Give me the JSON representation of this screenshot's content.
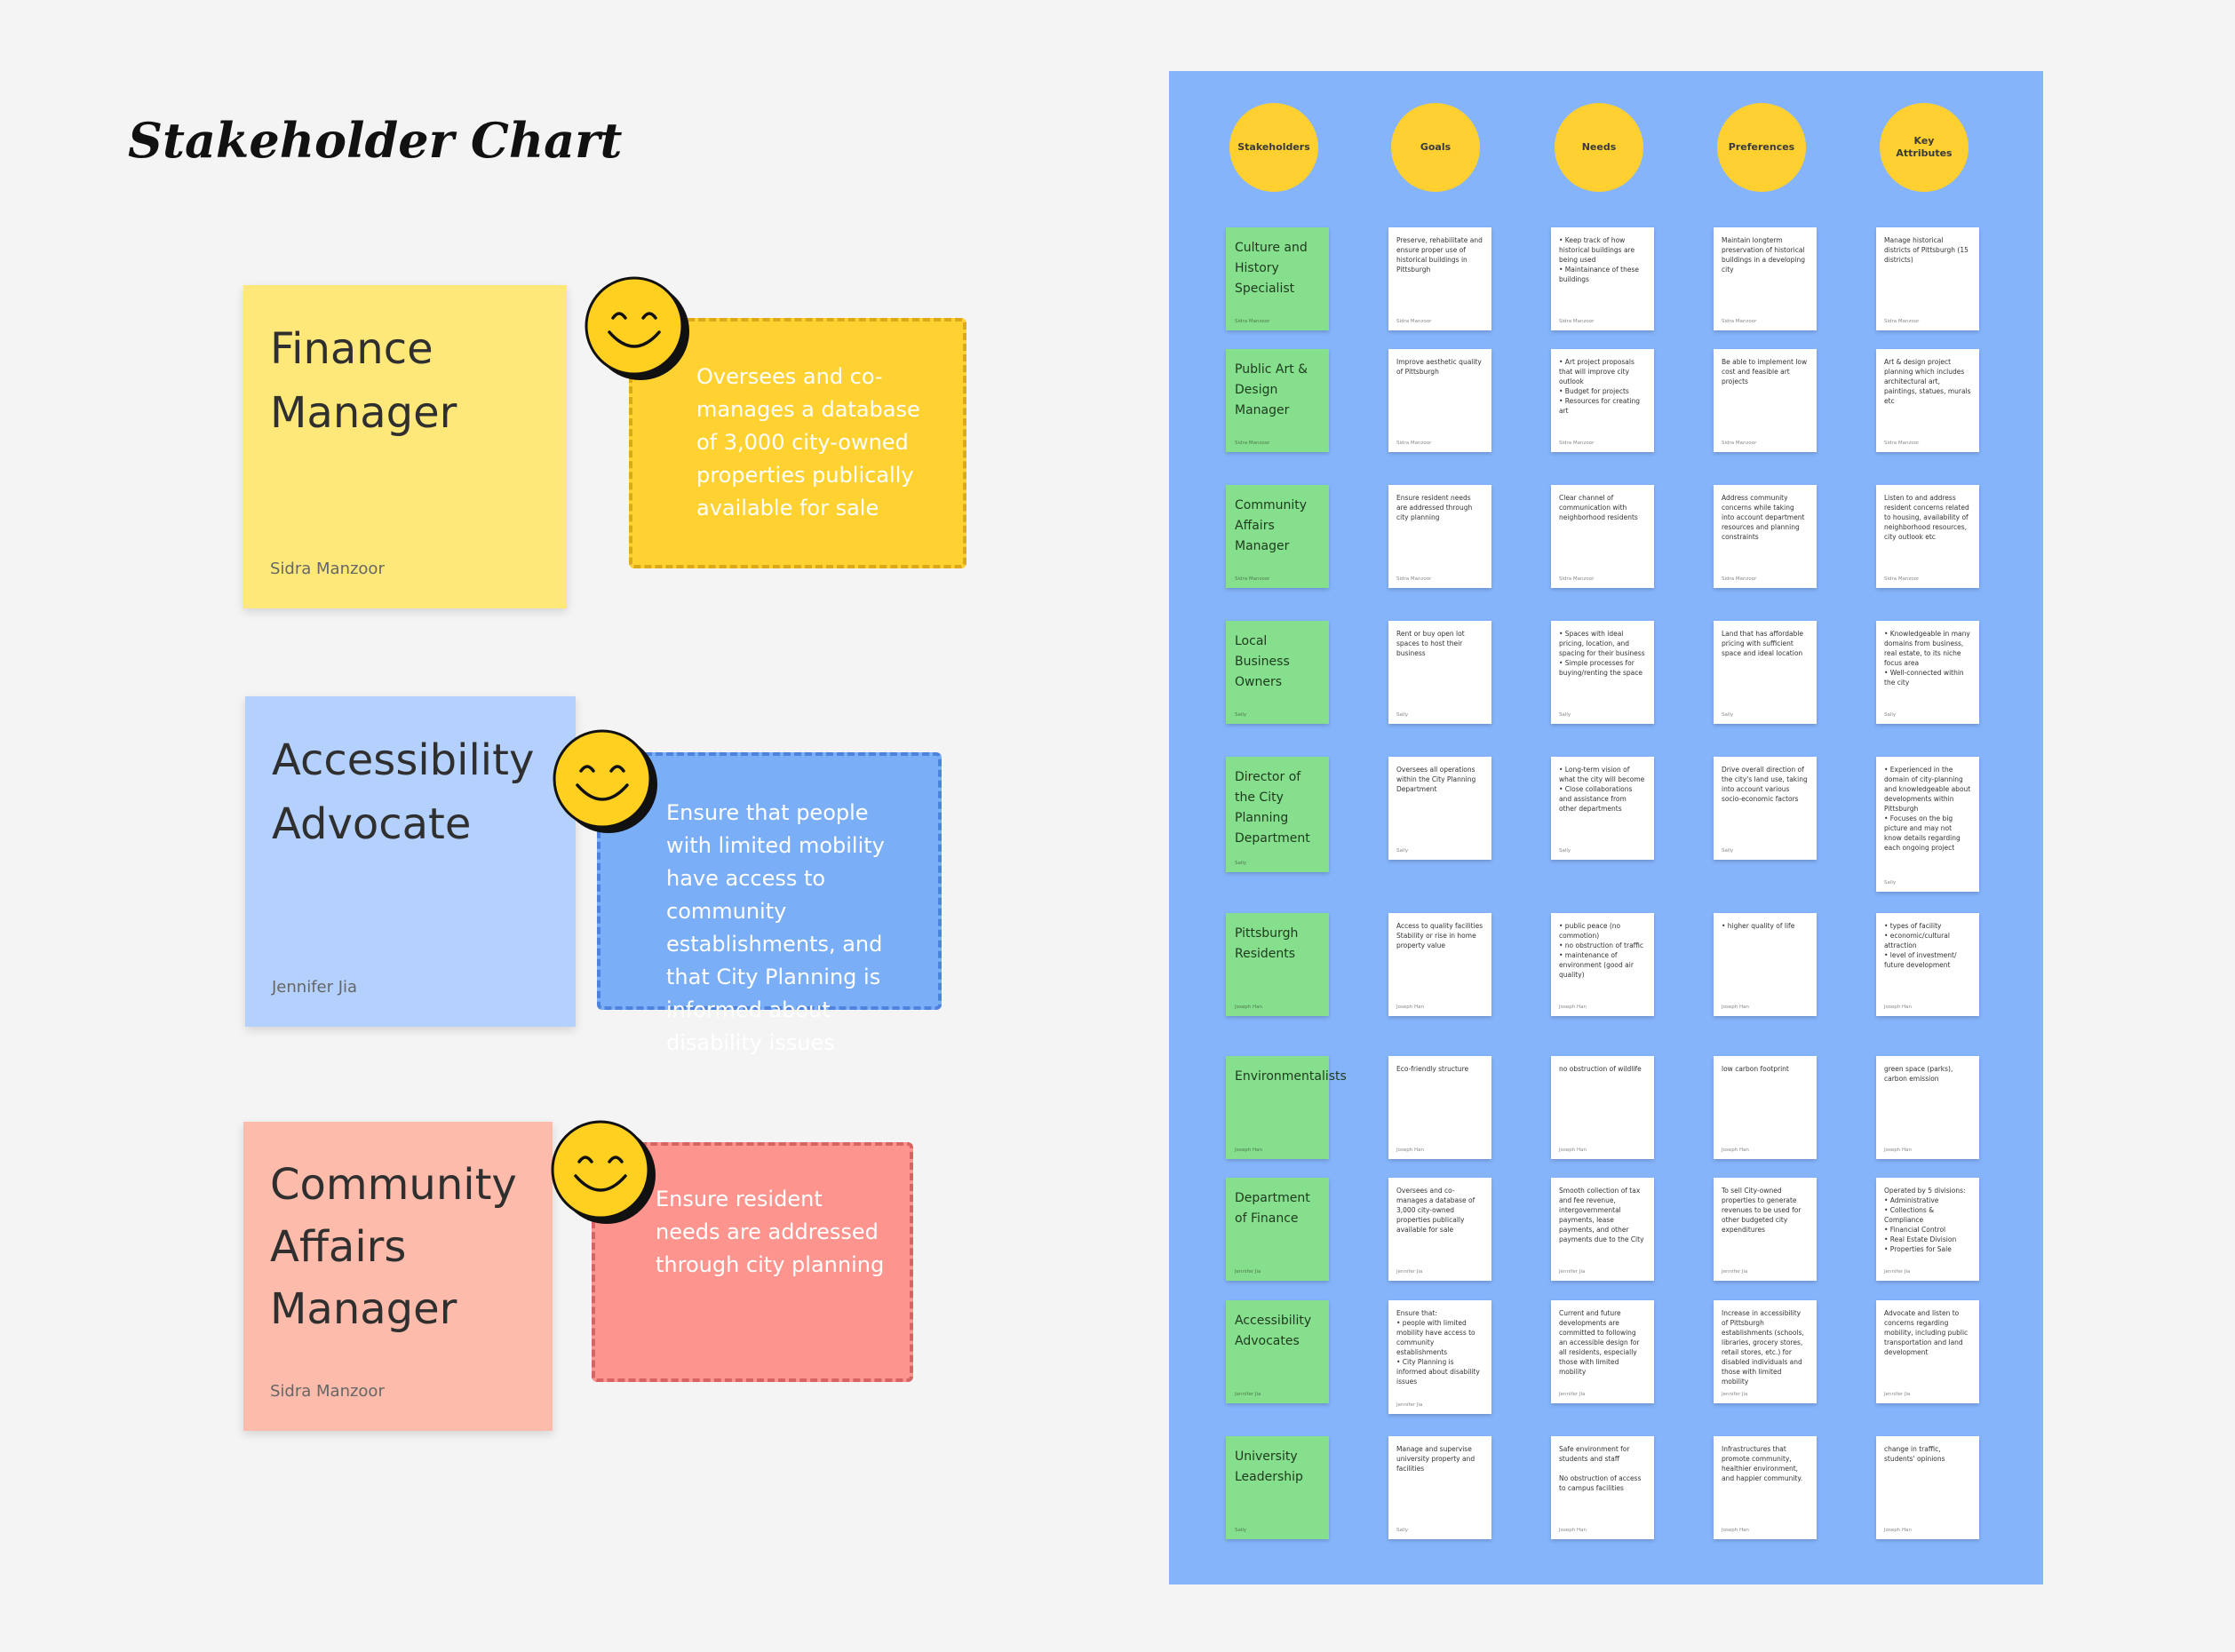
{
  "title": "Stakeholder Chart",
  "stickies": [
    {
      "role": "Finance Manager",
      "author": "Sidra Manzoor",
      "note": "Oversees and co-manages a database of 3,000 city-owned properties publically available for sale"
    },
    {
      "role": "Accessibility Advocate",
      "author": "Jennifer Jia",
      "note": "Ensure that people with limited mobility have access to community establishments, and that City Planning is informed about disability issues"
    },
    {
      "role": "Community Affairs Manager",
      "author": "Sidra Manzoor",
      "note": "Ensure resident needs are addressed through city planning"
    }
  ],
  "board": {
    "headers": [
      "Stakeholders",
      "Goals",
      "Needs",
      "Preferences",
      "Key Attributes"
    ],
    "rows": [
      {
        "stakeholder": "Culture and History Specialist",
        "author": "Sidra Manzoor",
        "cells": [
          "Preserve, rehabilitate and ensure proper use of historical buildings in Pittsburgh",
          "• Keep track of how historical buildings are being used\n• Maintainance of these buildings",
          "Maintain longterm preservation of historical buildings in a developing city",
          "Manage historical districts of Pittsburgh (15 districts)"
        ]
      },
      {
        "stakeholder": "Public Art & Design Manager",
        "author": "Sidra Manzoor",
        "cells": [
          "Improve aesthetic quality of Pittsburgh",
          "• Art project proposals that will improve city outlook\n• Budget for projects\n• Resources for creating art",
          "Be able to implement low cost and feasible art projects",
          "Art & design project planning which includes architectural art, paintings, statues, murals etc"
        ]
      },
      {
        "stakeholder": "Community Affairs Manager",
        "author": "Sidra Manzoor",
        "cells": [
          "Ensure resident needs are addressed through city planning",
          "Clear channel of communication with neighborhood residents",
          "Address community concerns while taking into account department resources and planning constraints",
          "Listen to and address resident concerns related to housing, availability of neighborhood resources, city outlook etc"
        ]
      },
      {
        "stakeholder": "Local Business Owners",
        "author": "Sally",
        "cells": [
          "Rent or buy open lot spaces to host their business",
          "• Spaces with ideal pricing, location, and spacing for their business\n• Simple processes for buying/renting the space",
          "Land that has affordable pricing with sufficient space and ideal location",
          "• Knowledgeable in many domains from business, real estate, to its niche focus area\n• Well-connected within the city"
        ]
      },
      {
        "stakeholder": "Director of the City Planning Department",
        "author": "Sally",
        "cells": [
          "Oversees all operations within the City Planning Department",
          "• Long-term vision of what the city will become\n• Close collaborations and assistance from other departments",
          "Drive overall direction of the city's land use, taking into account various socio-economic factors",
          "• Experienced in the domain of city-planning and knowledgeable about developments within Pittsburgh\n• Focuses on the big picture and may not know details regarding each ongoing project"
        ]
      },
      {
        "stakeholder": "Pittsburgh Residents",
        "author": "Joseph Han",
        "cells": [
          "Access to quality facilities\nStability or rise in home property value",
          "• public peace (no commotion)\n• no obstruction of traffic\n• maintenance of environment (good air quality)",
          "• higher quality of life",
          "• types of facility\n• economic/cultural attraction\n• level of investment/ future development"
        ]
      },
      {
        "stakeholder": "Environmentalists",
        "author": "Joseph Han",
        "cells": [
          "Eco-friendly structure",
          "no obstruction of wildlife",
          "low carbon footprint",
          "green space (parks), carbon emission"
        ]
      },
      {
        "stakeholder": "Department of Finance",
        "author": "Jennifer Jia",
        "cells": [
          "Oversees and co-manages a database of 3,000 city-owned properties publically available for sale",
          "Smooth collection of tax and fee revenue, intergovernmental payments, lease payments, and other payments due to the City",
          "To sell City-owned properties to generate revenues to be used for other budgeted city expenditures",
          "Operated by 5 divisions:\n• Administrative\n• Collections & Compliance\n• Financial Control\n• Real Estate Division\n• Properties for Sale"
        ]
      },
      {
        "stakeholder": "Accessibility Advocates",
        "author": "Jennifer Jia",
        "cells": [
          "Ensure that:\n• people with limited mobility have access to community establishments\n• City Planning is informed about disability issues",
          "Current and future developments are committed to following an accessible design for all residents, especially those with limited mobility",
          "Increase in accessibility of Pittsburgh establishments (schools, libraries, grocery stores, retail stores, etc.) for disabled individuals and those with limited mobility",
          "Advocate and listen to concerns regarding mobility, including public transportation and land development"
        ]
      },
      {
        "stakeholder": "University Leadership",
        "author": "Sally",
        "cells": [
          "Manage and supervise university property and facilities",
          "Safe environment for students and staff\n\nNo obstruction of access to campus facilities",
          "Infrastructures that promote community, healthier environment, and happier community.",
          "change in traffic, students' opinions"
        ]
      }
    ],
    "cell_authors": [
      [
        "Sidra Manzoor",
        "Sidra Manzoor",
        "Sidra Manzoor",
        "Sidra Manzoor"
      ],
      [
        "Sidra Manzoor",
        "Sidra Manzoor",
        "Sidra Manzoor",
        "Sidra Manzoor"
      ],
      [
        "Sidra Manzoor",
        "Sidra Manzoor",
        "Sidra Manzoor",
        "Sidra Manzoor"
      ],
      [
        "Sally",
        "Sally",
        "Sally",
        "Sally"
      ],
      [
        "Sally",
        "Sally",
        "Sally",
        "Sally"
      ],
      [
        "Joseph Han",
        "Joseph Han",
        "Joseph Han",
        "Joseph Han"
      ],
      [
        "Joseph Han",
        "Joseph Han",
        "Joseph Han",
        "Joseph Han"
      ],
      [
        "Jennifer Jia",
        "Jennifer Jia",
        "Jennifer Jia",
        "Jennifer Jia"
      ],
      [
        "Jennifer Jia",
        "Jennifer Jia",
        "Jennifer Jia",
        "Jennifer Jia"
      ],
      [
        "Sally",
        "Joseph Han",
        "Joseph Han",
        "Joseph Han"
      ]
    ]
  },
  "colors": {
    "sticky_yellow": "#ffe87a",
    "note_yellow": "#ffd232",
    "sticky_blue": "#b4d0fc",
    "note_blue": "#7aaef6",
    "sticky_salmon": "#fdbcab",
    "note_red": "#fe948e",
    "board": "#86b4fb",
    "header": "#ffd02f",
    "green_card": "#86df8d"
  }
}
